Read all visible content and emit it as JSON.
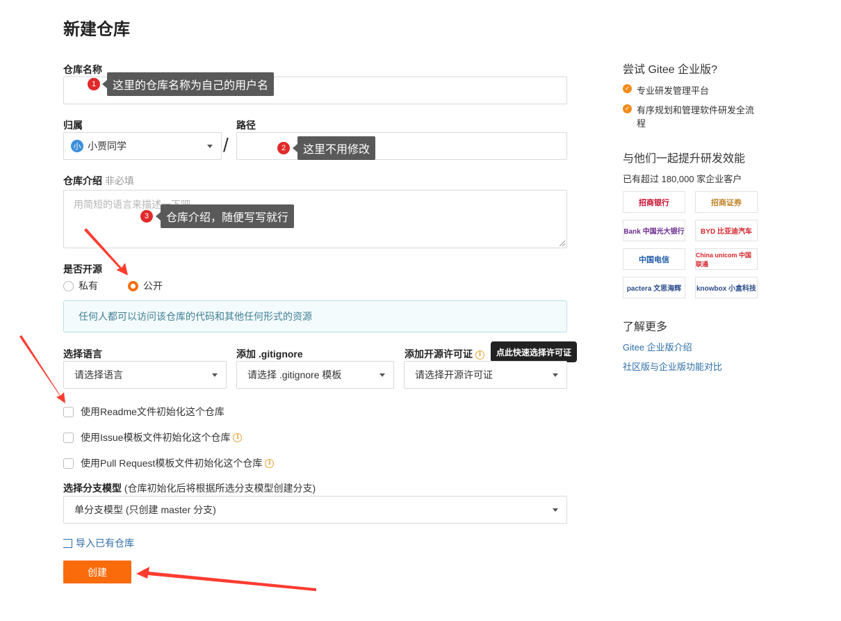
{
  "page": {
    "title": "新建仓库"
  },
  "form": {
    "repo_name": {
      "label": "仓库名称",
      "value": ""
    },
    "owner": {
      "label": "归属",
      "avatar_letter": "小",
      "value": "小贾同学"
    },
    "path": {
      "label": "路径",
      "separator": "/",
      "value": ""
    },
    "description": {
      "label": "仓库介绍",
      "label_hint": "非必填",
      "placeholder": "用简短的语言来描述一下吧"
    },
    "visibility": {
      "label": "是否开源",
      "options": [
        {
          "label": "私有",
          "checked": false
        },
        {
          "label": "公开",
          "checked": true
        }
      ],
      "info": "任何人都可以访问该仓库的代码和其他任何形式的资源"
    },
    "language": {
      "label": "选择语言",
      "value": "请选择语言"
    },
    "gitignore": {
      "label": "添加 .gitignore",
      "value": "请选择 .gitignore 模板"
    },
    "license": {
      "label": "添加开源许可证",
      "value": "请选择开源许可证",
      "tooltip": "点此快速选择许可证"
    },
    "init_options": [
      {
        "label": "使用Readme文件初始化这个仓库",
        "has_info": false
      },
      {
        "label": "使用Issue模板文件初始化这个仓库",
        "has_info": true
      },
      {
        "label": "使用Pull Request模板文件初始化这个仓库",
        "has_info": true
      }
    ],
    "branch_model": {
      "label": "选择分支模型",
      "label_hint": "(仓库初始化后将根据所选分支模型创建分支)",
      "value": "单分支模型 (只创建 master 分支)"
    },
    "import_link": "导入已有仓库",
    "create_button": "创建"
  },
  "annotations": [
    {
      "number": "1",
      "text": "这里的仓库名称为自己的用户名"
    },
    {
      "number": "2",
      "text": "这里不用修改"
    },
    {
      "number": "3",
      "text": "仓库介绍，随便写写就行"
    }
  ],
  "sidebar": {
    "enterprise_title": "尝试 Gitee 企业版?",
    "features": [
      "专业研发管理平台",
      "有序规划和管理软件研发全流程"
    ],
    "efficiency_title": "与他们一起提升研发效能",
    "customers_text": "已有超过 180,000 家企业客户",
    "logos": [
      {
        "name": "招商银行",
        "color": "#c8102e"
      },
      {
        "name": "招商证券",
        "color": "#c0842a"
      },
      {
        "name": "Bank 中国光大银行",
        "color": "#6a2c8c"
      },
      {
        "name": "BYD 比亚迪汽车",
        "color": "#d6252b"
      },
      {
        "name": "中国电信",
        "color": "#1d59a8"
      },
      {
        "name": "China unicom 中国联通",
        "color": "#d6252b"
      },
      {
        "name": "pactera 文思海辉",
        "color": "#2c4c8c"
      },
      {
        "name": "knowbox 小盒科技",
        "color": "#2c4c8c"
      }
    ],
    "learn_more_title": "了解更多",
    "links": [
      "Gitee 企业版介绍",
      "社区版与企业版功能对比"
    ]
  },
  "colors": {
    "accent": "#fa6b0b",
    "annotation_red": "#e02a2a",
    "arrow_red": "#ff3b30",
    "link": "#2d6ea8"
  }
}
